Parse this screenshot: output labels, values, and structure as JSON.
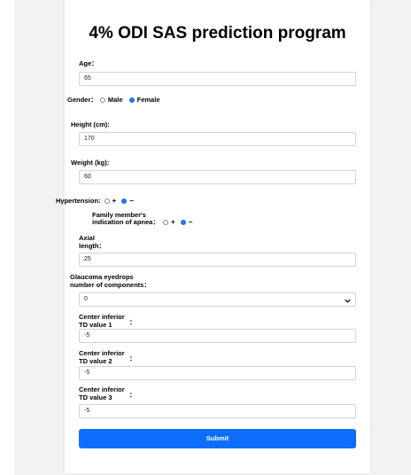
{
  "title": "4% ODI SAS prediction program",
  "age": {
    "label": "Age：",
    "value": "65"
  },
  "gender": {
    "label": "Gender：",
    "options": [
      "Male",
      "Female"
    ],
    "selected": "Female"
  },
  "height": {
    "label": "Height (cm):",
    "value": "170"
  },
  "weight": {
    "label": "Weight (kg):",
    "value": "60"
  },
  "hypertension": {
    "label": "Hypertension:",
    "options": [
      "+",
      "−"
    ],
    "selected": "−"
  },
  "family": {
    "label_line1": "Family member's",
    "label_line2": "indication of apnea：",
    "options": [
      "+",
      "−"
    ],
    "selected": "−"
  },
  "axial": {
    "label_line1": "Axial",
    "label_line2": "length：",
    "value": "25"
  },
  "glaucoma": {
    "label_line1": "Glaucoma eyedrops",
    "label_line2": "number of components：",
    "value": "0"
  },
  "td1": {
    "label_line1": "Center inferior",
    "label_line2": "TD value 1",
    "colon": "：",
    "value": "-5"
  },
  "td2": {
    "label_line1": "Center inferior",
    "label_line2": "TD value 2",
    "colon": "：",
    "value": "-5"
  },
  "td3": {
    "label_line1": "Center inferior",
    "label_line2": "TD value 3",
    "colon": "：",
    "value": "-5"
  },
  "submit_label": "Submit",
  "colors": {
    "accent": "#0d6efd",
    "background": "#f2f2f2"
  }
}
